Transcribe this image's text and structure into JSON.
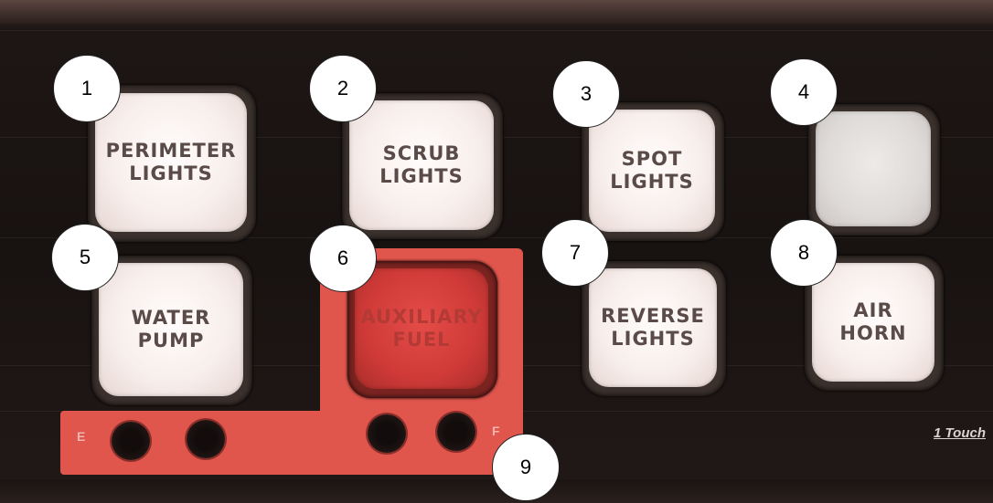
{
  "buttons": [
    {
      "label": "PERIMETER\nLIGHTS",
      "callout": "1"
    },
    {
      "label": "SCRUB\nLIGHTS",
      "callout": "2"
    },
    {
      "label": "SPOT\nLIGHTS",
      "callout": "3"
    },
    {
      "label": "",
      "callout": "4"
    },
    {
      "label": "WATER\nPUMP",
      "callout": "5"
    },
    {
      "label": "AUXILIARY\nFUEL",
      "callout": "6"
    },
    {
      "label": "REVERSE\nLIGHTS",
      "callout": "7"
    },
    {
      "label": "AIR\nHORN",
      "callout": "8"
    }
  ],
  "fuel_gauge": {
    "empty_label": "E",
    "full_label": "F",
    "callout": "9"
  },
  "brand": "1 Touch",
  "colors": {
    "panel": "#1b1513",
    "red_plate": "#e0554c",
    "button_face": "#f8efec",
    "button_text": "#5a4b48"
  }
}
